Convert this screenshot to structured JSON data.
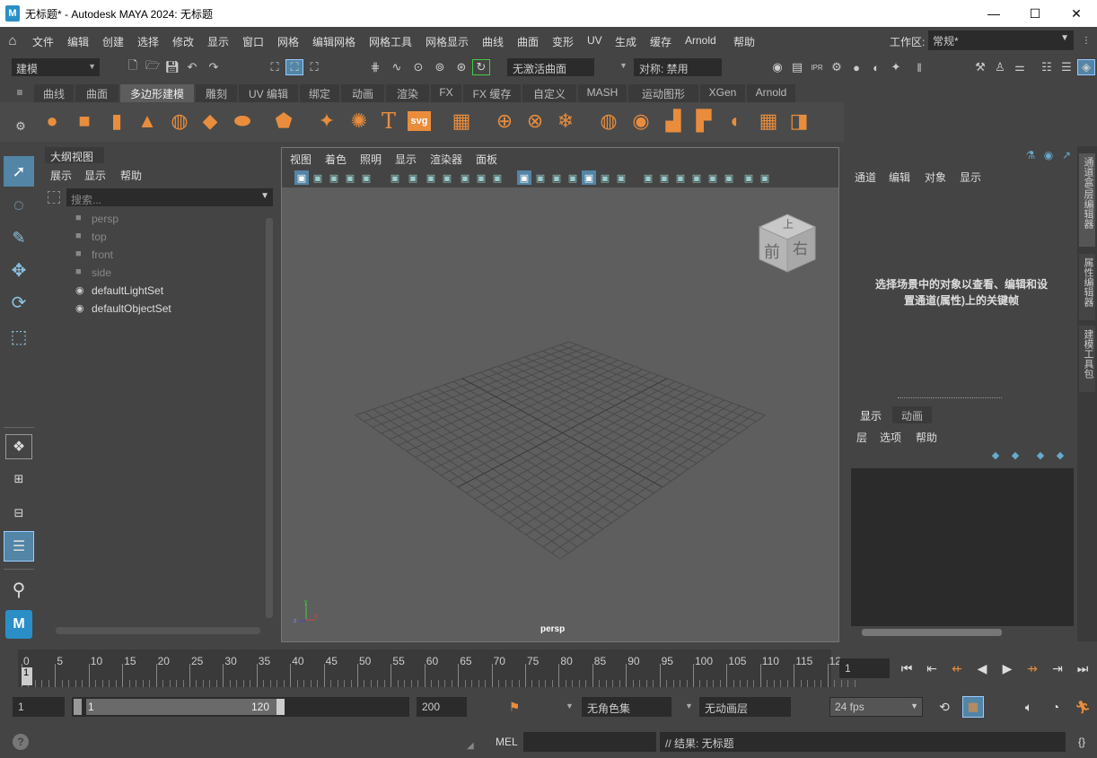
{
  "window": {
    "title": "无标题* - Autodesk MAYA 2024: 无标题",
    "min": "—",
    "max": "☐",
    "close": "✕"
  },
  "menu": {
    "items": [
      "文件",
      "编辑",
      "创建",
      "选择",
      "修改",
      "显示",
      "窗口",
      "网格",
      "编辑网格",
      "网格工具",
      "网格显示",
      "曲线",
      "曲面",
      "变形",
      "UV",
      "生成",
      "缓存",
      "Arnold",
      "帮助"
    ],
    "workspace_label": "工作区:",
    "workspace_value": "常规*"
  },
  "statusline": {
    "mode": "建模",
    "live_surface": "无激活曲面",
    "symmetry": "对称: 禁用"
  },
  "shelf": {
    "tabs": [
      "曲线",
      "曲面",
      "多边形建模",
      "雕刻",
      "UV 编辑",
      "绑定",
      "动画",
      "渲染",
      "FX",
      "FX 缓存",
      "自定义",
      "MASH",
      "运动图形",
      "XGen",
      "Arnold"
    ],
    "active": "多边形建模",
    "svg_label": "svg",
    "text_icon": "T"
  },
  "outliner": {
    "title": "大纲视图",
    "menu": [
      "展示",
      "显示",
      "帮助"
    ],
    "search_placeholder": "搜索...",
    "items": [
      "persp",
      "top",
      "front",
      "side",
      "defaultLightSet",
      "defaultObjectSet"
    ]
  },
  "viewport": {
    "menu": [
      "视图",
      "着色",
      "照明",
      "显示",
      "渲染器",
      "面板"
    ],
    "camera_label": "persp",
    "cube_labels": {
      "top": "上",
      "front": "前",
      "right": "右"
    }
  },
  "channelbox": {
    "menu": [
      "通道",
      "编辑",
      "对象",
      "显示"
    ],
    "hint_line1": "选择场景中的对象以查看、编辑和设",
    "hint_line2": "置通道(属性)上的关键帧",
    "layer_tabs": [
      "显示",
      "动画"
    ],
    "layer_menu": [
      "层",
      "选项",
      "帮助"
    ]
  },
  "sidetabs": [
    "通道盒/层编辑器",
    "属性编辑器",
    "建模工具包"
  ],
  "timeline": {
    "ticks": [
      "0",
      "5",
      "10",
      "15",
      "20",
      "25",
      "30",
      "35",
      "40",
      "45",
      "50",
      "55",
      "60",
      "65",
      "70",
      "75",
      "80",
      "85",
      "90",
      "95",
      "100",
      "105",
      "110",
      "115",
      "12"
    ],
    "current_marker": "1",
    "current_frame": "1"
  },
  "range": {
    "start": "1",
    "playback_start": "1",
    "playback_end": "120",
    "end": "200",
    "character_set": "无角色集",
    "anim_layer": "无动画层",
    "fps": "24 fps"
  },
  "cmdline": {
    "lang": "MEL",
    "result": "// 结果: 无标题"
  },
  "colors": {
    "accent": "#e98d3d",
    "bg": "#444444",
    "dark": "#2b2b2b",
    "viewport": "#5e5e5e"
  }
}
